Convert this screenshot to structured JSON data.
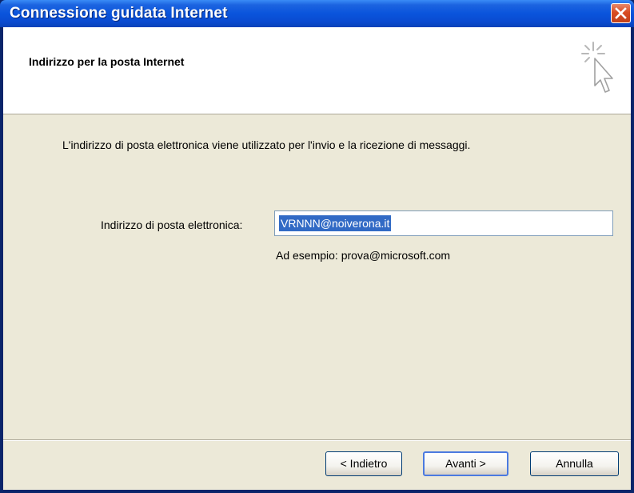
{
  "window": {
    "title": "Connessione guidata Internet",
    "close_icon": "close-icon",
    "title_color": "#0a54dc",
    "close_color": "#d94c22"
  },
  "header": {
    "title": "Indirizzo per la posta Internet",
    "icon": "wizard-cursor-icon"
  },
  "main": {
    "description": "L'indirizzo di posta elettronica viene utilizzato per l'invio e la ricezione di messaggi.",
    "email_label": "Indirizzo di posta elettronica:",
    "email_value": "VRNNN@noiverona.it",
    "email_selected": true,
    "example": "Ad esempio: prova@microsoft.com"
  },
  "buttons": {
    "back": "< Indietro",
    "next": "Avanti >",
    "cancel": "Annulla"
  },
  "colors": {
    "dialog_background": "#ece9d8",
    "selection": "#316ac5"
  }
}
